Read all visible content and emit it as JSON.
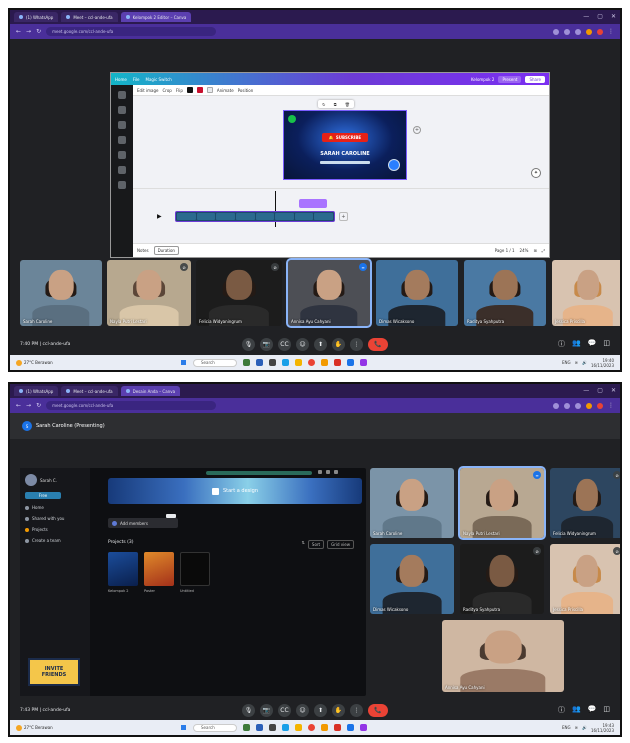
{
  "shot1": {
    "browser": {
      "tabs": [
        {
          "label": "(1) WhatsApp"
        },
        {
          "label": "Meet – ccl-ande-ufa"
        },
        {
          "label": "Kelompok 2 Editor – Canva",
          "active": true
        }
      ],
      "address": "meet.google.com/ccl-ande-ufa",
      "window_controls": {
        "minimize": "—",
        "maximize": "▢",
        "close": "✕"
      }
    },
    "canva": {
      "topbar": {
        "home": "Home",
        "file": "File",
        "resize": "Magic Switch",
        "share_label": "Share",
        "present_label": "Present",
        "project_title": "Kelompok 2"
      },
      "toolbar": {
        "edit_image": "Edit image",
        "crop": "Crop",
        "flip": "Flip",
        "animate": "Animate",
        "position": "Position",
        "colors": [
          "#111111",
          "#c8102e",
          "#e8eaed"
        ]
      },
      "design": {
        "subscribe_label": "SUBSCRIBE",
        "headline": "SARAH CAROLINE",
        "accent_color": "#e62117"
      },
      "status": {
        "notes": "Notes",
        "timer": "Duration",
        "zoom": "24%",
        "page": "Page 1 / 1"
      }
    },
    "meet": {
      "participants": [
        {
          "name": "Sarah Caroline"
        },
        {
          "name": "Nayla Putri Lestari"
        },
        {
          "name": "Felicia Widyaningrum"
        },
        {
          "name": "Annisa Ayu Cahyani",
          "speaking": true
        },
        {
          "name": "Dimas Wicaksono"
        },
        {
          "name": "Raditya Syahputra"
        },
        {
          "name": "Jessica Priscilla"
        }
      ],
      "time": "7:40 PM",
      "meeting_code": "ccl-ande-ufa"
    },
    "taskbar": {
      "weather": "27°C Berawan",
      "search": "Search",
      "time": "19:40",
      "date": "16/11/2023",
      "lang": "ENG"
    }
  },
  "shot2": {
    "browser": {
      "tabs": [
        {
          "label": "(1) WhatsApp"
        },
        {
          "label": "Meet – ccl-ande-ufa"
        },
        {
          "label": "Desain Anda – Canva",
          "active": true
        }
      ],
      "address": "meet.google.com/ccl-ande-ufa"
    },
    "presenter_bar": "Sarah Caroline (Presenting)",
    "canva_home": {
      "account_name": "Sarah C.",
      "account_btn": "Free",
      "nav": [
        {
          "label": "Home"
        },
        {
          "label": "Shared with you"
        },
        {
          "label": "Projects",
          "highlight": true
        },
        {
          "label": "Create a team"
        }
      ],
      "invite": {
        "line1": "INVITE",
        "line2": "FRIENDS"
      },
      "hero_label": "Start a design",
      "sub_btn": "Add members",
      "section_title": "Projects (3)",
      "sort": {
        "sort_label": "Sort",
        "view_label": "Grid view"
      },
      "projects": [
        {
          "label": "Kelompok 2",
          "color": "#1b4d9b"
        },
        {
          "label": "Poster",
          "color": "#e08a2a"
        },
        {
          "label": "Untitled",
          "color": "#0a0a0a"
        }
      ]
    },
    "meet": {
      "participants": [
        {
          "name": "Sarah Caroline"
        },
        {
          "name": "Nayla Putri Lestari",
          "speaking": true
        },
        {
          "name": "Felicia Widyaningrum"
        },
        {
          "name": "Dimas Wicaksono"
        },
        {
          "name": "Raditya Syahputra"
        },
        {
          "name": "Jessica Priscilla"
        },
        {
          "name": "Annisa Ayu Cahyani"
        }
      ],
      "time": "7:43 PM",
      "meeting_code": "ccl-ande-ufa"
    },
    "taskbar": {
      "weather": "27°C Berawan",
      "search": "Search",
      "time": "19:43",
      "date": "16/11/2023",
      "lang": "ENG"
    }
  },
  "icons": {
    "mic": "🎙",
    "cam": "📷",
    "cc": "CC",
    "emoji": "☺",
    "present": "⬆",
    "hand": "✋",
    "more": "⋮",
    "end": "📞",
    "info": "ⓘ",
    "people": "👥",
    "chat": "💬",
    "activities": "◫"
  }
}
